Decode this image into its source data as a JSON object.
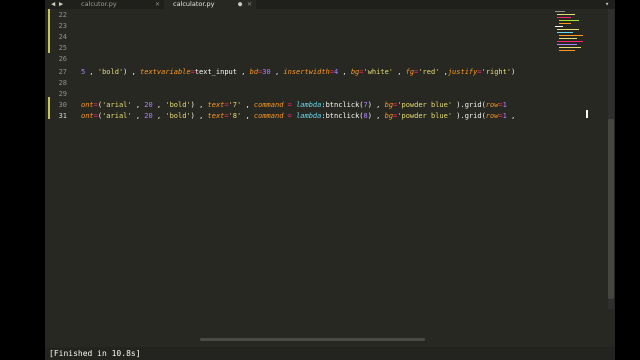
{
  "tabs": [
    {
      "label": "calcutor.py",
      "active": false,
      "close": "✕"
    },
    {
      "label": "calculator.py",
      "active": true,
      "close": "✕"
    }
  ],
  "tabbar": {
    "back": "◀",
    "forward": "▶",
    "new_tab": "▾",
    "modified": "●"
  },
  "editor": {
    "line_numbers": [
      "22",
      "23",
      "24",
      "25",
      "26",
      "27",
      "28",
      "29",
      "30",
      "31"
    ],
    "current_line": "31"
  },
  "code": {
    "line27": [
      {
        "t": "5",
        "c": "n"
      },
      {
        "t": " , ",
        "c": "p"
      },
      {
        "t": "'bold'",
        "c": "s"
      },
      {
        "t": ") , ",
        "c": "p"
      },
      {
        "t": "textvariable",
        "c": "a"
      },
      {
        "t": "=",
        "c": "k"
      },
      {
        "t": "text_input",
        "c": "p"
      },
      {
        "t": " , ",
        "c": "p"
      },
      {
        "t": "bd",
        "c": "a"
      },
      {
        "t": "=",
        "c": "k"
      },
      {
        "t": "30",
        "c": "n"
      },
      {
        "t": " , ",
        "c": "p"
      },
      {
        "t": "insertwidth",
        "c": "a"
      },
      {
        "t": "=",
        "c": "k"
      },
      {
        "t": "4",
        "c": "n"
      },
      {
        "t": " , ",
        "c": "p"
      },
      {
        "t": "bg",
        "c": "a"
      },
      {
        "t": "=",
        "c": "k"
      },
      {
        "t": "'white'",
        "c": "s"
      },
      {
        "t": " , ",
        "c": "p"
      },
      {
        "t": "fg",
        "c": "a"
      },
      {
        "t": "=",
        "c": "k"
      },
      {
        "t": "'red'",
        "c": "s"
      },
      {
        "t": " ,",
        "c": "p"
      },
      {
        "t": "justify",
        "c": "a"
      },
      {
        "t": "=",
        "c": "k"
      },
      {
        "t": "'right'",
        "c": "s"
      },
      {
        "t": ")",
        "c": "p"
      }
    ],
    "line30": [
      {
        "t": "ont",
        "c": "a"
      },
      {
        "t": "=",
        "c": "k"
      },
      {
        "t": "(",
        "c": "p"
      },
      {
        "t": "'arial'",
        "c": "s"
      },
      {
        "t": " , ",
        "c": "p"
      },
      {
        "t": "20",
        "c": "n"
      },
      {
        "t": " , ",
        "c": "p"
      },
      {
        "t": "'bold'",
        "c": "s"
      },
      {
        "t": ") , ",
        "c": "p"
      },
      {
        "t": "text",
        "c": "a"
      },
      {
        "t": "=",
        "c": "k"
      },
      {
        "t": "'7'",
        "c": "s"
      },
      {
        "t": " , ",
        "c": "p"
      },
      {
        "t": "command",
        "c": "a"
      },
      {
        "t": " = ",
        "c": "k"
      },
      {
        "t": "lambda",
        "c": "i"
      },
      {
        "t": ":btnclick(",
        "c": "p"
      },
      {
        "t": "7",
        "c": "n"
      },
      {
        "t": ") , ",
        "c": "p"
      },
      {
        "t": "bg",
        "c": "a"
      },
      {
        "t": "=",
        "c": "k"
      },
      {
        "t": "'powder blue'",
        "c": "s"
      },
      {
        "t": " ).grid(",
        "c": "p"
      },
      {
        "t": "row",
        "c": "a"
      },
      {
        "t": "=",
        "c": "k"
      },
      {
        "t": "1",
        "c": "n"
      }
    ],
    "line31": [
      {
        "t": "ont",
        "c": "a"
      },
      {
        "t": "=",
        "c": "k"
      },
      {
        "t": "(",
        "c": "p"
      },
      {
        "t": "'arial'",
        "c": "s"
      },
      {
        "t": " , ",
        "c": "p"
      },
      {
        "t": "20",
        "c": "n"
      },
      {
        "t": " , ",
        "c": "p"
      },
      {
        "t": "'bold'",
        "c": "s"
      },
      {
        "t": ") , ",
        "c": "p"
      },
      {
        "t": "text",
        "c": "a"
      },
      {
        "t": "=",
        "c": "k"
      },
      {
        "t": "'8'",
        "c": "s"
      },
      {
        "t": " , ",
        "c": "p"
      },
      {
        "t": "command",
        "c": "a"
      },
      {
        "t": " = ",
        "c": "k"
      },
      {
        "t": "lambda",
        "c": "i"
      },
      {
        "t": ":btnclick(",
        "c": "p"
      },
      {
        "t": "8",
        "c": "n"
      },
      {
        "t": ") , ",
        "c": "p"
      },
      {
        "t": "bg",
        "c": "a"
      },
      {
        "t": "=",
        "c": "k"
      },
      {
        "t": "'powder blue'",
        "c": "s"
      },
      {
        "t": " ).grid(",
        "c": "p"
      },
      {
        "t": "row",
        "c": "a"
      },
      {
        "t": "=",
        "c": "k"
      },
      {
        "t": "1",
        "c": "n"
      },
      {
        "t": " ,",
        "c": "p"
      }
    ]
  },
  "output_panel": {
    "text": "[Finished in 10.8s]"
  },
  "colors": {
    "background": "#272822",
    "string": "#e6db74",
    "keyword": "#f92672",
    "number": "#ae81ff",
    "argument": "#fd971f",
    "storage": "#66d9ef",
    "plain": "#f8f8f2"
  }
}
